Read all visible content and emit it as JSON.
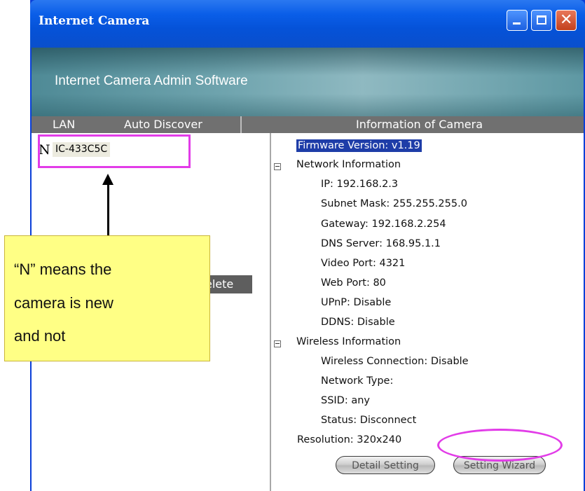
{
  "window": {
    "title": "Internet Camera"
  },
  "banner": {
    "app_title": "Internet Camera Admin Software"
  },
  "tabs": {
    "lan": "LAN",
    "auto_discover": "Auto Discover"
  },
  "info_panel": {
    "header": "Information of Camera",
    "firmware": "Firmware Version: v1.19",
    "network_header": "Network Information",
    "ip": "IP:  192.168.2.3",
    "subnet": "Subnet Mask:  255.255.255.0",
    "gateway": "Gateway:  192.168.2.254",
    "dns": "DNS Server:  168.95.1.1",
    "video_port": "Video Port:  4321",
    "web_port": "Web Port:  80",
    "upnp": "UPnP:  Disable",
    "ddns": "DDNS:  Disable",
    "wireless_header": "Wireless Information",
    "wireless_connection": "Wireless Connection: Disable",
    "network_type": "Network Type:",
    "ssid": "SSID: any",
    "status": "Status: Disconnect",
    "resolution": "Resolution: 320x240"
  },
  "camera_list": [
    {
      "badge": "N",
      "name": "IC-433C5C"
    }
  ],
  "left_panel": {
    "delete_label": "elete"
  },
  "buttons": {
    "detail_setting": "Detail Setting",
    "setting_wizard": "Setting Wizard"
  },
  "annotation": {
    "callout_lines": [
      "“N” means the",
      "camera is new",
      "and not"
    ],
    "highlight_color": "#e23ce8",
    "callout_color": "#ffff85"
  },
  "icons": {
    "minimize": "minimize-icon",
    "maximize": "maximize-icon",
    "close": "close-icon",
    "collapse": "tree-collapse-icon",
    "arrow": "arrow-up-icon"
  }
}
